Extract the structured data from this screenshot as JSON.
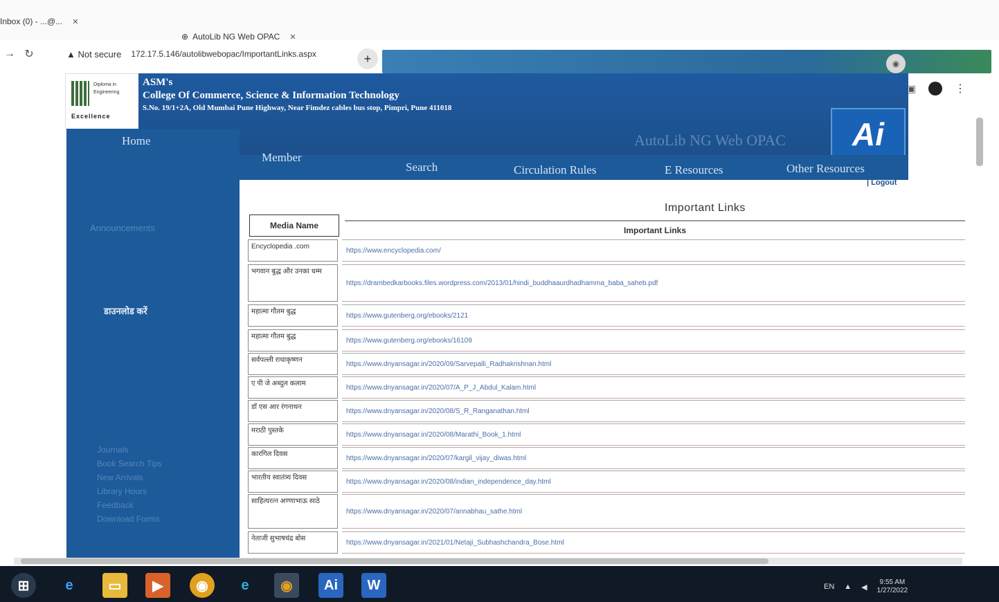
{
  "browser": {
    "tab1_title": "Inbox (0) - ...@...",
    "tab2_title": "AutoLib NG Web OPAC",
    "address_warning": "Not secure",
    "url": "172.17.5.146/autolibwebopac/ImportantLinks.aspx"
  },
  "header": {
    "college_line1": "ASM's",
    "college_line2": "College Of Commerce, Science & Information Technology",
    "college_addr": "S.No. 19/1+2A, Old Mumbai Pune Highway, Near Fimdez cables bus stop, Pimpri, Pune 411018",
    "opac_title": "AutoLib NG Web OPAC",
    "logo_letters": "Ai"
  },
  "nav": {
    "home": "Home",
    "member": "Member",
    "search": "Search",
    "circulation": "Circulation Rules",
    "eresources": "E Resources",
    "other": "Other Resources",
    "logout": "| Logout"
  },
  "sidebar": {
    "link1": "Announcements",
    "link2": "डाउनलोड करें",
    "list": [
      "Journals",
      "Book Search Tips",
      "New Arrivals",
      "Library Hours",
      "Feedback",
      "Download Forms"
    ]
  },
  "content": {
    "title": "Important Links",
    "col_media": "Media Name",
    "col_links": "Important Links",
    "rows": [
      {
        "name": "Encyclopedia .com",
        "link": "https://www.encyclopedia.com/"
      },
      {
        "name": "भगवान बुद्ध और उनका धम्म",
        "link": "https://drambedkarbooks.files.wordpress.com/2013/01/hindi_buddhaaurdhadhamma_baba_saheb.pdf"
      },
      {
        "name": "महात्मा गौतम बुद्ध",
        "link": "https://www.gutenberg.org/ebooks/2121"
      },
      {
        "name": "महात्मा गौतम बुद्ध",
        "link": "https://www.gutenberg.org/ebooks/16109"
      },
      {
        "name": "सर्वपल्ली राधाकृष्णन",
        "link": "https://www.dnyansagar.in/2020/09/Sarvepalli_Radhakrishnan.html"
      },
      {
        "name": "ए पी जे अब्दुल कलाम",
        "link": "https://www.dnyansagar.in/2020/07/A_P_J_Abdul_Kalam.html"
      },
      {
        "name": "डॉ एस आर रंगनाथन",
        "link": "https://www.dnyansagar.in/2020/08/S_R_Ranganathan.html"
      },
      {
        "name": "मराठी पुस्तके",
        "link": "https://www.dnyansagar.in/2020/08/Marathi_Book_1.html"
      },
      {
        "name": "कारगिल दिवस",
        "link": "https://www.dnyansagar.in/2020/07/kargil_vijay_diwas.html"
      },
      {
        "name": "भारतीय स्वातंत्र्य दिवस",
        "link": "https://www.dnyansagar.in/2020/08/indian_independence_day.html"
      },
      {
        "name": "साहित्यरत्न अण्णाभाऊ साठे",
        "link": "https://www.dnyansagar.in/2020/07/annabhau_sathe.html"
      },
      {
        "name": "नेताजी सुभाषचंद्र बोस",
        "link": "https://www.dnyansagar.in/2021/01/Netaji_Subhashchandra_Bose.html"
      }
    ]
  },
  "taskbar": {
    "lang": "EN",
    "time": "9:55 AM",
    "date": "1/27/2022"
  },
  "colors": {
    "header_blue": "#1d4f8a",
    "link_blue": "#4b6ea8"
  }
}
